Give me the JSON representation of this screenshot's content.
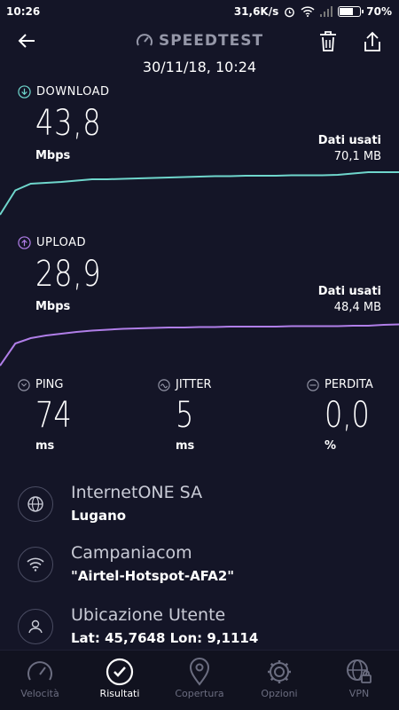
{
  "status_bar": {
    "time": "10:26",
    "speed": "31,6K/s",
    "battery": "70%",
    "battery_level": 0.7
  },
  "header": {
    "title": "SPEEDTEST",
    "datetime": "30/11/18, 10:24"
  },
  "download": {
    "label": "DOWNLOAD",
    "value": "43,8",
    "unit": "Mbps",
    "used_label": "Dati usati",
    "used_value": "70,1 MB",
    "color": "#6fd6cc",
    "series": [
      0.0,
      0.55,
      0.7,
      0.72,
      0.74,
      0.77,
      0.8,
      0.8,
      0.81,
      0.82,
      0.83,
      0.84,
      0.85,
      0.86,
      0.87,
      0.87,
      0.88,
      0.88,
      0.88,
      0.89,
      0.89,
      0.89,
      0.9,
      0.93,
      0.96,
      0.96,
      0.96
    ]
  },
  "upload": {
    "label": "UPLOAD",
    "value": "28,9",
    "unit": "Mbps",
    "used_label": "Dati usati",
    "used_value": "48,4 MB",
    "color": "#b07ee8",
    "series": [
      0.0,
      0.5,
      0.62,
      0.68,
      0.72,
      0.76,
      0.79,
      0.81,
      0.83,
      0.84,
      0.85,
      0.86,
      0.86,
      0.87,
      0.87,
      0.88,
      0.88,
      0.88,
      0.88,
      0.89,
      0.89,
      0.89,
      0.89,
      0.9,
      0.9,
      0.92,
      0.93
    ]
  },
  "metrics": [
    {
      "label": "PING",
      "value": "74",
      "unit": "ms"
    },
    {
      "label": "JITTER",
      "value": "5",
      "unit": "ms"
    },
    {
      "label": "PERDITA",
      "value": "0,0",
      "unit": "%"
    }
  ],
  "info": [
    {
      "icon": "globe-icon",
      "title": "InternetONE SA",
      "subtitle": "Lugano"
    },
    {
      "icon": "wifi-icon",
      "title": "Campaniacom",
      "subtitle": "\"Airtel-Hotspot-AFA2\""
    },
    {
      "icon": "user-icon",
      "title": "Ubicazione Utente",
      "subtitle": "Lat: 45,7648 Lon: 9,1114"
    }
  ],
  "nav": [
    {
      "label": "Velocità",
      "icon": "speedometer-icon",
      "active": false
    },
    {
      "label": "Risultati",
      "icon": "check-circle-icon",
      "active": true
    },
    {
      "label": "Copertura",
      "icon": "location-pin-icon",
      "active": false
    },
    {
      "label": "Opzioni",
      "icon": "gear-icon",
      "active": false
    },
    {
      "label": "VPN",
      "icon": "vpn-globe-icon",
      "active": false
    }
  ]
}
